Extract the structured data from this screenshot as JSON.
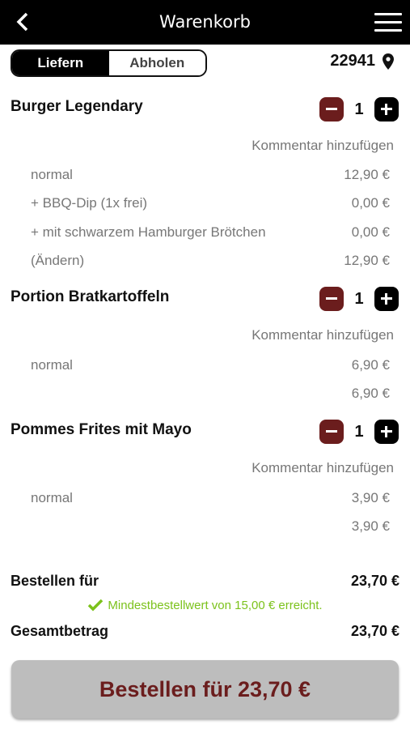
{
  "header": {
    "title": "Warenkorb",
    "back_icon": "back-arrow-icon",
    "menu_icon": "hamburger-menu-icon"
  },
  "mode": {
    "deliver_label": "Liefern",
    "pickup_label": "Abholen",
    "selected": "Liefern"
  },
  "location": {
    "zip": "22941",
    "icon": "location-pin-icon"
  },
  "items": [
    {
      "title": "Burger Legendary",
      "quantity": "1",
      "comment_label": "Kommentar hinzufügen",
      "lines": [
        {
          "label": "normal",
          "price": "12,90 €"
        },
        {
          "label": "+ BBQ-Dip (1x frei)",
          "price": "0,00 €"
        },
        {
          "label": "+ mit schwarzem Hamburger Brötchen",
          "price": "0,00 €"
        },
        {
          "label": "(Ändern)",
          "price": "12,90 €"
        }
      ]
    },
    {
      "title": "Portion Bratkartoffeln",
      "quantity": "1",
      "comment_label": "Kommentar hinzufügen",
      "lines": [
        {
          "label": "normal",
          "price": "6,90 €"
        },
        {
          "label": "",
          "price": "6,90 €"
        }
      ]
    },
    {
      "title": "Pommes Frites mit Mayo",
      "quantity": "1",
      "comment_label": "Kommentar hinzufügen",
      "lines": [
        {
          "label": "normal",
          "price": "3,90 €"
        },
        {
          "label": "",
          "price": "3,90 €"
        }
      ]
    }
  ],
  "summary": {
    "order_for_label": "Bestellen für",
    "order_for_value": "23,70 €",
    "min_notice": "Mindestbestellwert von 15,00 € erreicht.",
    "total_label": "Gesamtbetrag",
    "total_value": "23,70 €"
  },
  "order_button": {
    "label": "Bestellen für 23,70 €"
  },
  "colors": {
    "accent": "#6b1d1d",
    "success": "#7cc21c",
    "header_bg": "#000000"
  }
}
